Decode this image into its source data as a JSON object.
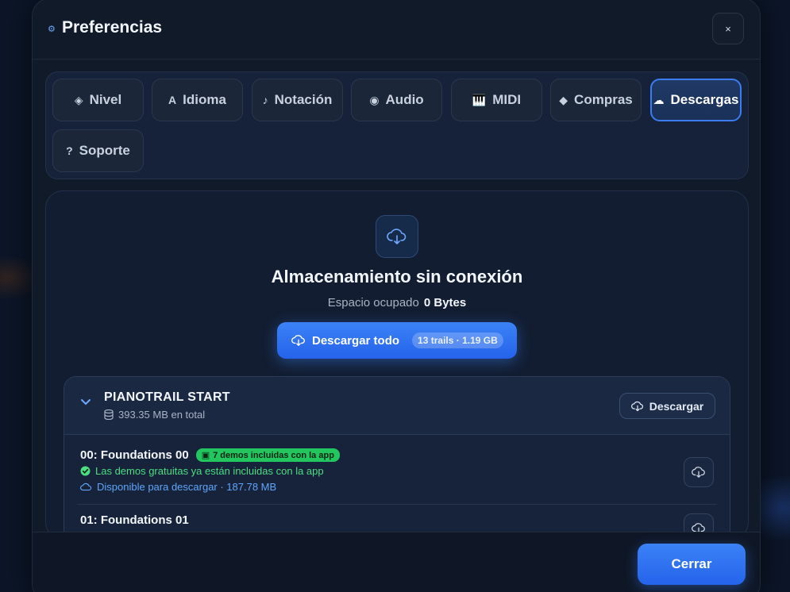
{
  "header": {
    "title": "Preferencias",
    "close_label": "×"
  },
  "tabs": [
    {
      "label": "Nivel",
      "icon": "◈"
    },
    {
      "label": "Idioma",
      "icon": "A"
    },
    {
      "label": "Notación",
      "icon": "♪"
    },
    {
      "label": "Audio",
      "icon": "◉"
    },
    {
      "label": "MIDI",
      "icon": "🎹"
    },
    {
      "label": "Compras",
      "icon": "◆"
    },
    {
      "label": "Descargas",
      "icon": "☁"
    },
    {
      "label": "Soporte",
      "icon": "?"
    }
  ],
  "active_tab": "Descargas",
  "storage": {
    "title": "Almacenamiento sin conexión",
    "used_label": "Espacio ocupado",
    "used_value": "0 Bytes",
    "download_all_label": "Descargar todo",
    "download_all_badge": "13 trails · 1.19 GB"
  },
  "pack": {
    "title": "PIANOTRAIL START",
    "size": "393.35 MB en total",
    "download_label": "Descargar",
    "items": [
      {
        "title": "00: Foundations 00",
        "badge": "7 demos incluidas con la app",
        "included_text": "Las demos gratuitas ya están incluidas con la app",
        "available_text": "Disponible para descargar · 187.78 MB"
      },
      {
        "title": "01: Foundations 01"
      }
    ]
  },
  "footer": {
    "close_label": "Cerrar"
  },
  "colors": {
    "accent": "#3b82f6",
    "success": "#22c55e",
    "background": "#111a29"
  }
}
